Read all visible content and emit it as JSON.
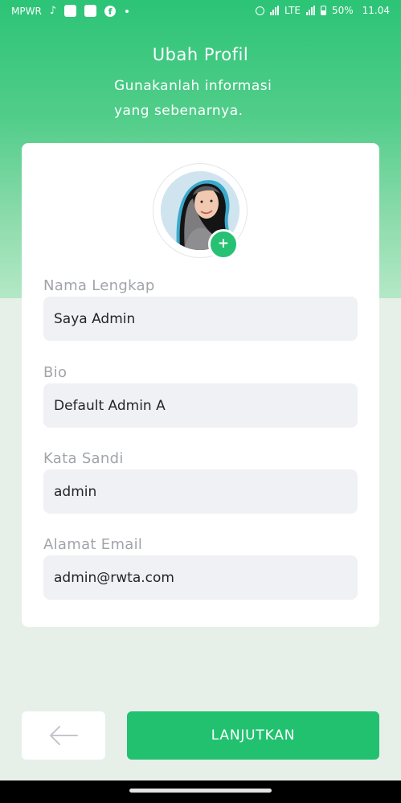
{
  "status_bar": {
    "carrier": "MPWR",
    "network": "LTE",
    "battery": "50%",
    "time": "11.04",
    "icons": [
      "tiktok-icon",
      "app-icon",
      "app-icon",
      "facebook-icon",
      "dot-icon",
      "alarm-icon",
      "signal-icon",
      "battery-icon"
    ]
  },
  "header": {
    "title": "Ubah Profil",
    "subtitle_line1": "Gunakanlah informasi",
    "subtitle_line2": "yang sebenarnya."
  },
  "profile": {
    "avatar": "profile-photo",
    "add_photo_label": "+"
  },
  "form": {
    "full_name": {
      "label": "Nama Lengkap",
      "value": "Saya Admin"
    },
    "bio": {
      "label": "Bio",
      "value": "Default Admin A"
    },
    "password": {
      "label": "Kata Sandi",
      "value": "admin"
    },
    "email": {
      "label": "Alamat Email",
      "value": "admin@rwta.com"
    }
  },
  "actions": {
    "back_icon": "arrow-left-icon",
    "next_label": "LANJUTKAN"
  },
  "colors": {
    "primary": "#22c170",
    "background": "#e7efe9",
    "input_bg": "#f0f1f5",
    "label": "#a1a4aa"
  }
}
